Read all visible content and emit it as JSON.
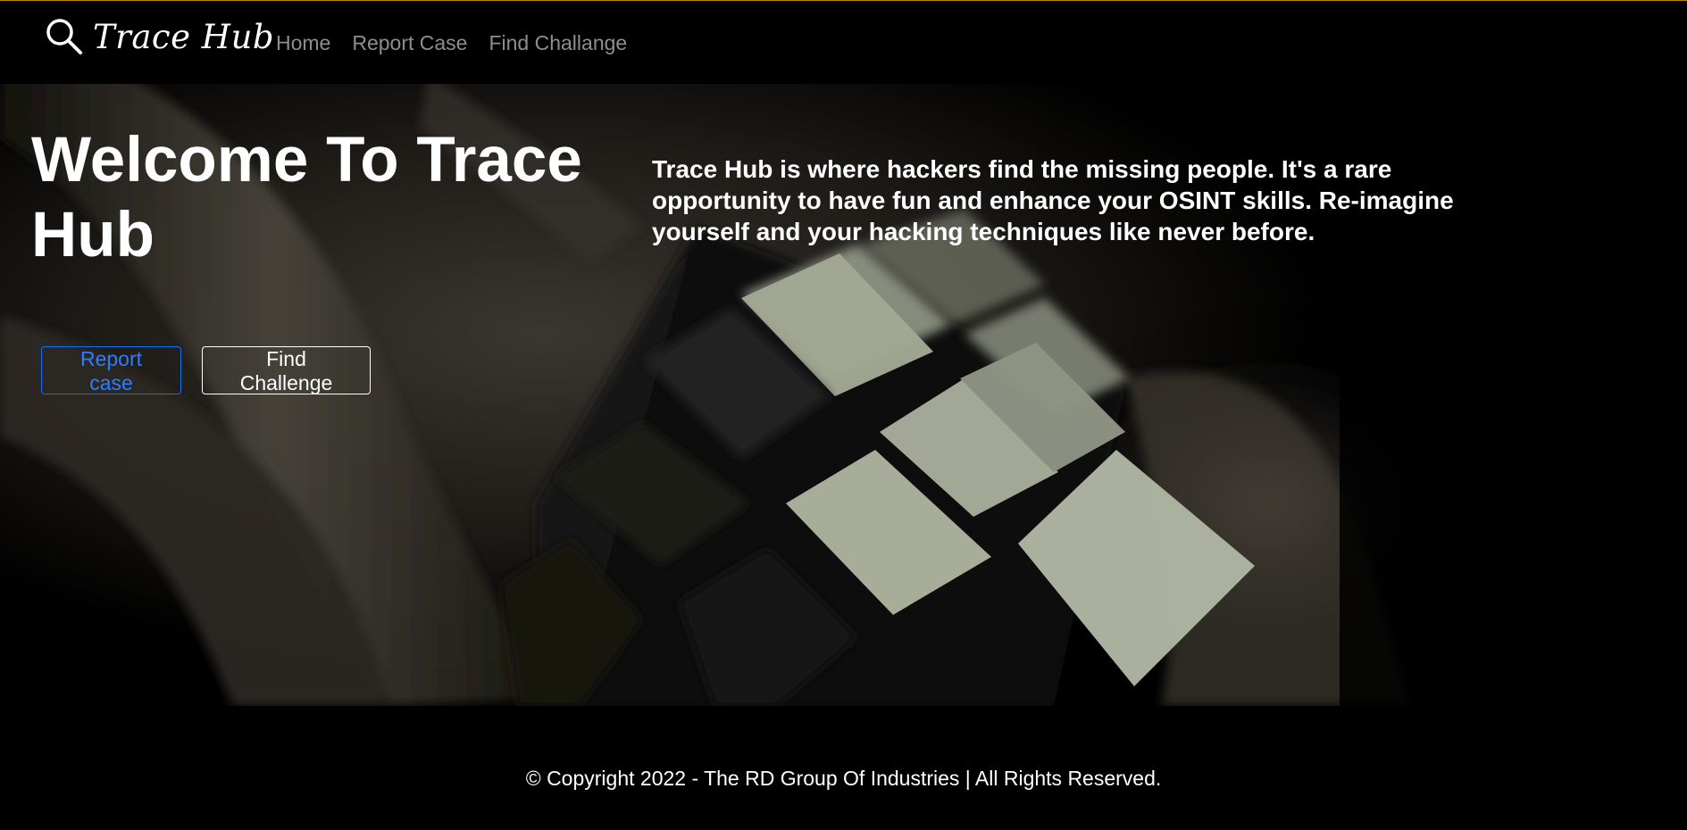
{
  "brand": {
    "name": "Trace Hub",
    "icon": "search-icon"
  },
  "nav": {
    "links": [
      {
        "label": "Home"
      },
      {
        "label": "Report Case"
      },
      {
        "label": "Find Challange"
      }
    ]
  },
  "hero": {
    "title": "Welcome To Trace Hub",
    "description": "Trace Hub is where hackers find the missing people. It's a rare opportunity to have fun and enhance your OSINT skills. Re-imagine yourself and your hacking techniques like never before.",
    "buttons": {
      "report_label": "Report case",
      "find_label": "Find Challenge"
    },
    "background_image": "hand holding rubik's cube"
  },
  "footer": {
    "copyright": "© Copyright 2022 - The RD Group Of Industries | All Rights Reserved."
  },
  "colors": {
    "background": "#000000",
    "top_border": "#b8860b",
    "nav_link": "#8e8e8e",
    "primary_outline": "#0d6efd",
    "cube_face": "#a7ad9a"
  }
}
